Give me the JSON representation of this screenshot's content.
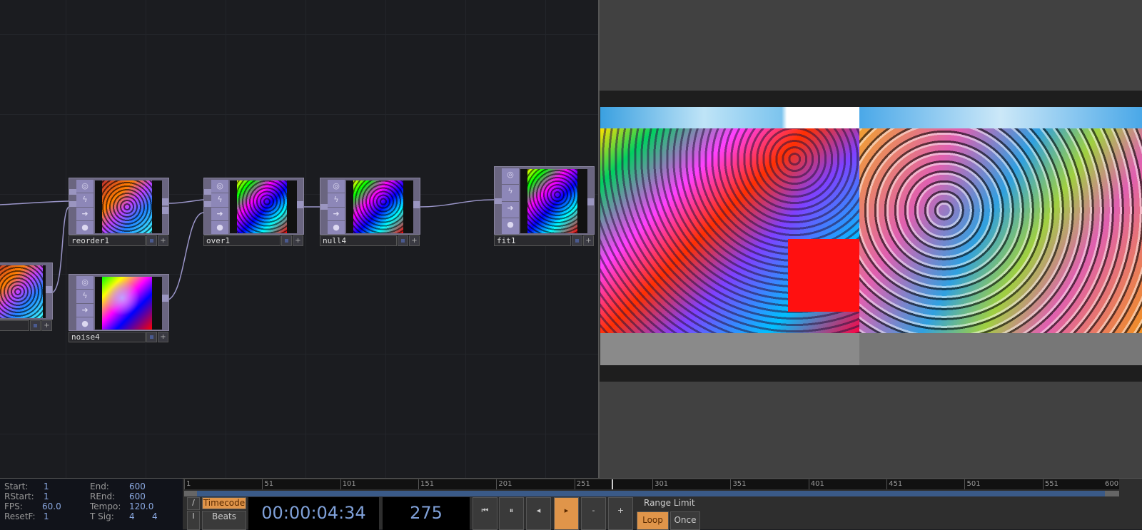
{
  "nodes": [
    {
      "name": "reorder1"
    },
    {
      "name": "over1"
    },
    {
      "name": "null4"
    },
    {
      "name": "fit1"
    },
    {
      "name": "noise4"
    },
    {
      "name": ""
    }
  ],
  "timeline": {
    "start_label": "Start:",
    "start": "1",
    "end_label": "End:",
    "end": "600",
    "rstart_label": "RStart:",
    "rstart": "1",
    "rend_label": "REnd:",
    "rend": "600",
    "fps_label": "FPS:",
    "fps": "60.0",
    "tempo_label": "Tempo:",
    "tempo": "120.0",
    "resetf_label": "ResetF:",
    "resetf": "1",
    "tsig_label": "T Sig:",
    "tsig_a": "4",
    "tsig_b": "4",
    "ruler_ticks": [
      "1",
      "51",
      "101",
      "151",
      "201",
      "251",
      "301",
      "351",
      "401",
      "451",
      "501",
      "551",
      "600"
    ],
    "current_frame": 275,
    "timecode_label": "Timecode",
    "beats_label": "Beats",
    "timecode": "00:00:04:34",
    "frame": "275",
    "range_limit_label": "Range Limit",
    "loop_label": "Loop",
    "once_label": "Once",
    "slash_label": "/",
    "i_label": "I",
    "minus_label": "-",
    "plus_label": "+"
  }
}
